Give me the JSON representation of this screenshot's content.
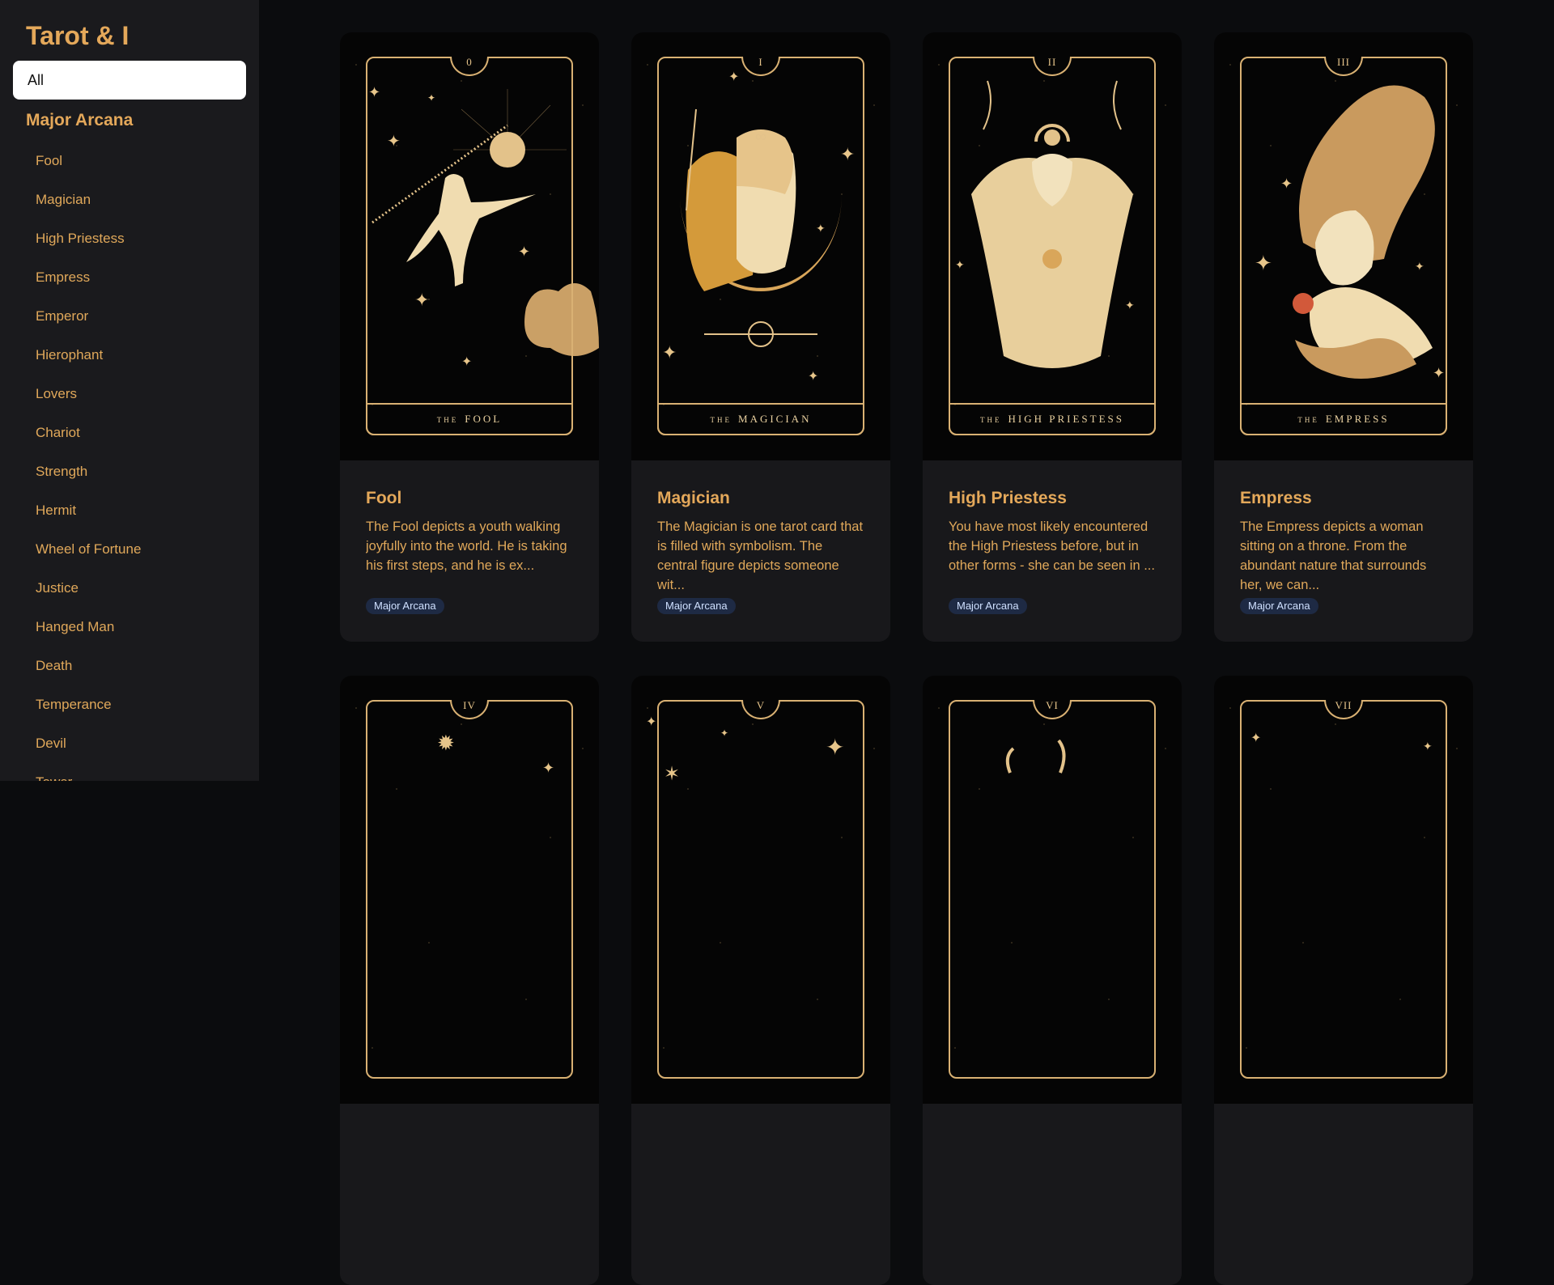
{
  "app": {
    "title": "Tarot & I"
  },
  "sidebar": {
    "all_label": "All",
    "section_title": "Major Arcana",
    "items": [
      "Fool",
      "Magician",
      "High Priestess",
      "Empress",
      "Emperor",
      "Hierophant",
      "Lovers",
      "Chariot",
      "Strength",
      "Hermit",
      "Wheel of Fortune",
      "Justice",
      "Hanged Man",
      "Death",
      "Temperance",
      "Devil",
      "Tower"
    ]
  },
  "cards": [
    {
      "numeral": "0",
      "the": "THE",
      "banner": "FOOL",
      "title": "Fool",
      "description": "The Fool depicts a youth walking joyfully into the world. He is taking his first steps, and he is ex...",
      "tag": "Major Arcana"
    },
    {
      "numeral": "I",
      "the": "THE",
      "banner": "MAGICIAN",
      "title": "Magician",
      "description": "The Magician is one tarot card that is filled with symbolism. The central figure depicts someone wit...",
      "tag": "Major Arcana"
    },
    {
      "numeral": "II",
      "the": "THE",
      "banner": "HIGH PRIESTESS",
      "title": "High Priestess",
      "description": "You have most likely encountered the High Priestess before, but in other forms - she can be seen in ...",
      "tag": "Major Arcana"
    },
    {
      "numeral": "III",
      "the": "THE",
      "banner": "EMPRESS",
      "title": "Empress",
      "description": "The Empress depicts a woman sitting on a throne. From the abundant nature that surrounds her, we can...",
      "tag": "Major Arcana"
    },
    {
      "numeral": "IV"
    },
    {
      "numeral": "V"
    },
    {
      "numeral": "VI"
    },
    {
      "numeral": "VII"
    }
  ],
  "colors": {
    "accent": "#e4a85a",
    "sidebar_bg": "#1a1a1d",
    "page_bg": "#0b0c0e",
    "card_bg": "#18181b",
    "gold": "#d9b173",
    "tag_bg": "#1e2a44"
  }
}
